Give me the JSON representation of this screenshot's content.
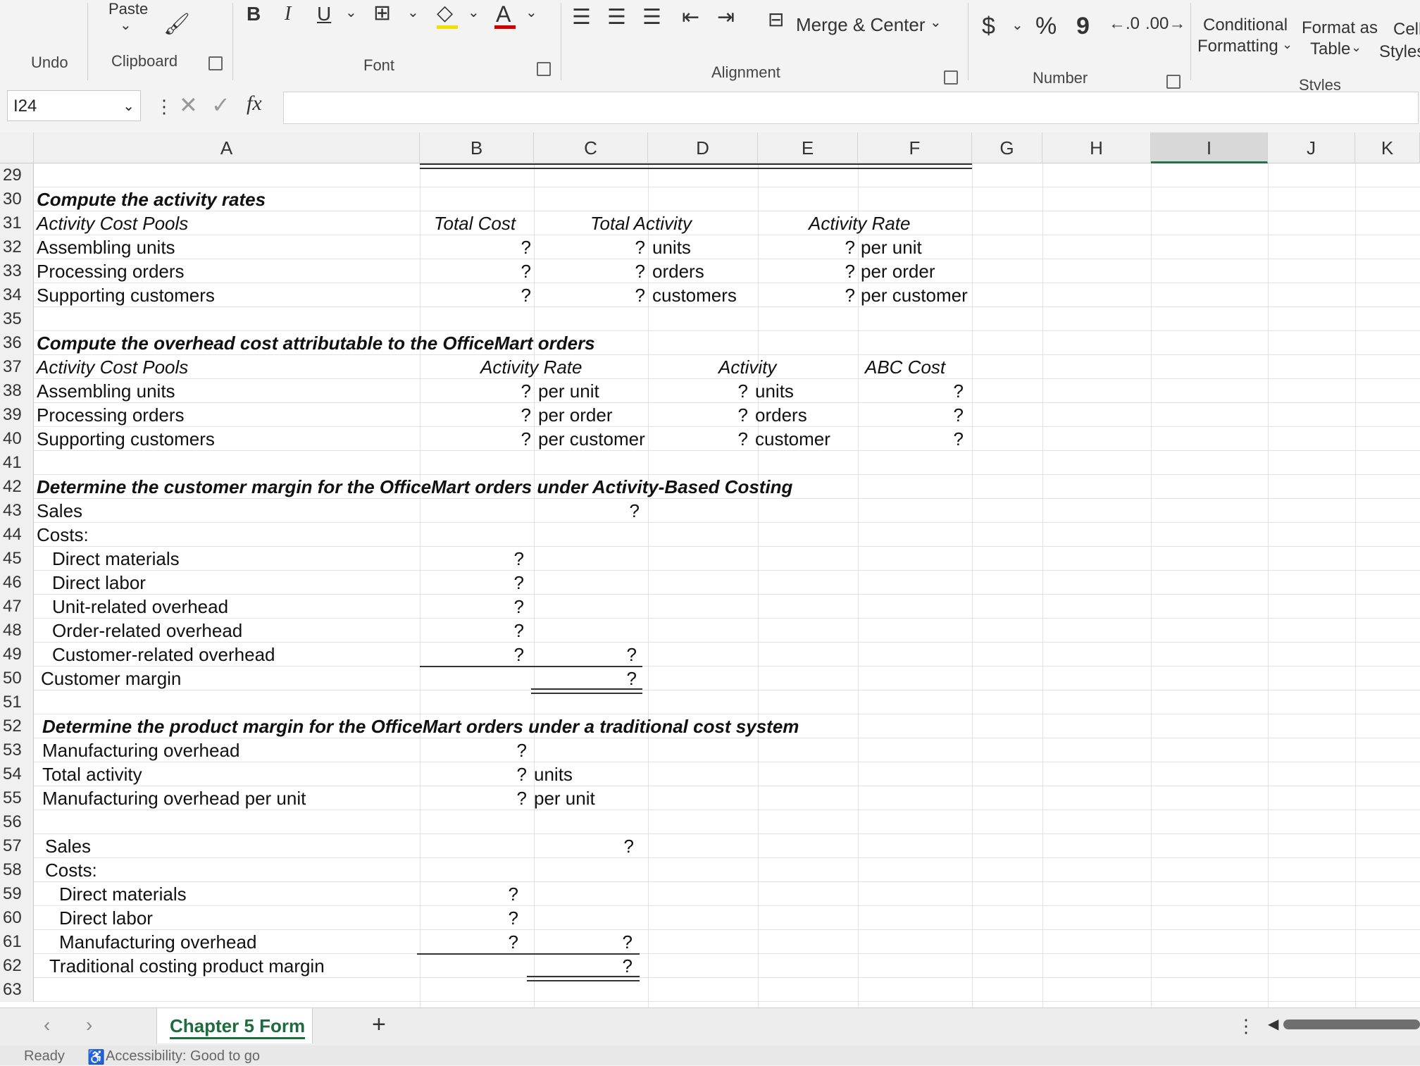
{
  "ribbon": {
    "undo_label": "Undo",
    "paste_label": "Paste",
    "clipboard_label": "Clipboard",
    "font_label": "Font",
    "alignment_label": "Alignment",
    "number_label": "Number",
    "styles_label": "Styles",
    "bold": "B",
    "italic": "I",
    "underline": "U",
    "font_color": "A",
    "merge_center": "Merge & Center",
    "currency": "$",
    "percent": "%",
    "comma": "9",
    "conditional_formatting_1": "Conditional",
    "conditional_formatting_2": "Formatting",
    "format_as_table_1": "Format as",
    "format_as_table_2": "Table",
    "cell_styles_1": "Cell",
    "cell_styles_2": "Styles",
    "fx": "fx"
  },
  "name_box": "I24",
  "columns": [
    "A",
    "B",
    "C",
    "D",
    "E",
    "F",
    "G",
    "H",
    "I",
    "J",
    "K"
  ],
  "rows": {
    "r29": "29",
    "r30": {
      "num": "30",
      "a": "Compute the activity rates"
    },
    "r31": {
      "num": "31",
      "a": "Activity Cost Pools",
      "b": "Total Cost",
      "c": "Total Activity",
      "e": "Activity Rate"
    },
    "r32": {
      "num": "32",
      "a": "Assembling units",
      "b": "?",
      "c": "?",
      "c_unit": "units",
      "e": "?",
      "e_unit": "per unit"
    },
    "r33": {
      "num": "33",
      "a": "Processing orders",
      "b": "?",
      "c": "?",
      "c_unit": "orders",
      "e": "?",
      "e_unit": "per order"
    },
    "r34": {
      "num": "34",
      "a": "Supporting customers",
      "b": "?",
      "c": "?",
      "c_unit": "customers",
      "e": "?",
      "e_unit": "per customer"
    },
    "r35": "35",
    "r36": {
      "num": "36",
      "a": "Compute the overhead cost attributable to the OfficeMart orders"
    },
    "r37": {
      "num": "37",
      "a": "Activity Cost Pools",
      "b": "Activity Rate",
      "d": "Activity",
      "f": "ABC Cost"
    },
    "r38": {
      "num": "38",
      "a": "Assembling units",
      "b": "?",
      "b_unit": "per unit",
      "d": "?",
      "d_unit": "units",
      "f": "?"
    },
    "r39": {
      "num": "39",
      "a": "Processing orders",
      "b": "?",
      "b_unit": "per order",
      "d": "?",
      "d_unit": "orders",
      "f": "?"
    },
    "r40": {
      "num": "40",
      "a": "Supporting customers",
      "b": "?",
      "b_unit": "per customer",
      "d": "?",
      "d_unit": "customer",
      "f": "?"
    },
    "r41": "41",
    "r42": {
      "num": "42",
      "a": "Determine the customer margin for the OfficeMart orders under Activity-Based Costing"
    },
    "r43": {
      "num": "43",
      "a": "Sales",
      "c": "?"
    },
    "r44": {
      "num": "44",
      "a": "Costs:"
    },
    "r45": {
      "num": "45",
      "a": "Direct materials",
      "b": "?"
    },
    "r46": {
      "num": "46",
      "a": "Direct labor",
      "b": "?"
    },
    "r47": {
      "num": "47",
      "a": "Unit-related overhead",
      "b": "?"
    },
    "r48": {
      "num": "48",
      "a": "Order-related overhead",
      "b": "?"
    },
    "r49": {
      "num": "49",
      "a": "Customer-related overhead",
      "b": "?",
      "c": "?"
    },
    "r50": {
      "num": "50",
      "a": "Customer margin",
      "c": "?"
    },
    "r51": "51",
    "r52": {
      "num": "52",
      "a": "Determine the product margin for the OfficeMart orders under a traditional cost system"
    },
    "r53": {
      "num": "53",
      "a": "Manufacturing overhead",
      "b": "?"
    },
    "r54": {
      "num": "54",
      "a": "Total activity",
      "b": "?",
      "b_unit": "units"
    },
    "r55": {
      "num": "55",
      "a": "Manufacturing overhead per unit",
      "b": "?",
      "b_unit": "per unit"
    },
    "r56": "56",
    "r57": {
      "num": "57",
      "a": "Sales",
      "c": "?"
    },
    "r58": {
      "num": "58",
      "a": "Costs:"
    },
    "r59": {
      "num": "59",
      "a": "Direct materials",
      "b": "?"
    },
    "r60": {
      "num": "60",
      "a": "Direct labor",
      "b": "?"
    },
    "r61": {
      "num": "61",
      "a": "Manufacturing overhead",
      "b": "?",
      "c": "?"
    },
    "r62": {
      "num": "62",
      "a": "Traditional costing product margin",
      "c": "?"
    },
    "r63": "63"
  },
  "tabs": {
    "active": "Chapter 5 Form",
    "add": "+"
  },
  "status": {
    "ready": "Ready",
    "accessibility": "Accessibility: Good to go"
  }
}
